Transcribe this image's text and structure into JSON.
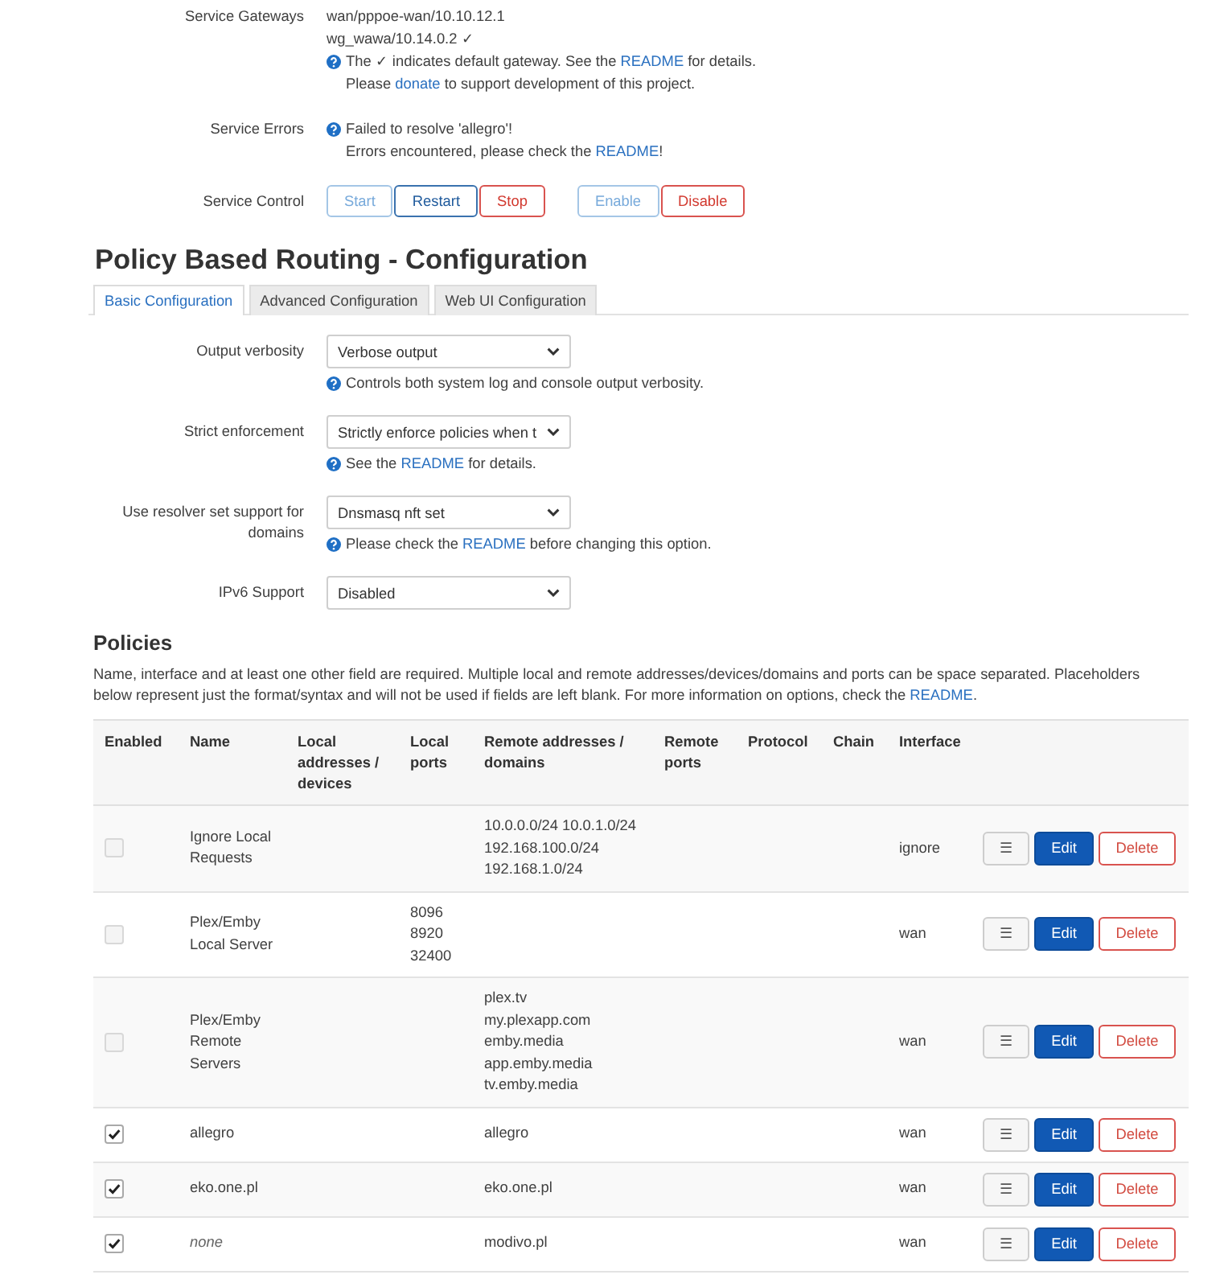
{
  "service": {
    "rows": [
      {
        "label": "Service Gateways",
        "lines": [
          "wan/pppoe-wan/10.10.12.1",
          "wg_wawa/10.14.0.2 ✓"
        ],
        "notes": [
          [
            {
              "kind": "text",
              "text": "The ✓ indicates default gateway. See the "
            },
            {
              "kind": "link",
              "text": "README"
            },
            {
              "kind": "text",
              "text": " for details."
            }
          ],
          [
            {
              "kind": "text",
              "text": "Please "
            },
            {
              "kind": "link",
              "text": "donate"
            },
            {
              "kind": "text",
              "text": " to support development of this project."
            }
          ]
        ]
      },
      {
        "label": "Service Errors",
        "notes": [
          [
            {
              "kind": "text",
              "text": "Failed to resolve 'allegro'!"
            }
          ],
          [
            {
              "kind": "text",
              "text": "Errors encountered, please check the "
            },
            {
              "kind": "link",
              "text": "README"
            },
            {
              "kind": "text",
              "text": "!"
            }
          ]
        ]
      }
    ],
    "control": {
      "label": "Service Control",
      "button_groups": [
        [
          {
            "label": "Start",
            "kind": "apply",
            "disabled": true
          },
          {
            "label": "Restart",
            "kind": "apply",
            "disabled": false
          },
          {
            "label": "Stop",
            "kind": "negative",
            "disabled": false
          }
        ],
        [
          {
            "label": "Enable",
            "kind": "apply",
            "disabled": true
          },
          {
            "label": "Disable",
            "kind": "negative",
            "disabled": false
          }
        ]
      ]
    }
  },
  "configuration": {
    "title": "Policy Based Routing - Configuration",
    "tabs": [
      {
        "label": "Basic Configuration",
        "selected": true
      },
      {
        "label": "Advanced Configuration",
        "selected": false
      },
      {
        "label": "Web UI Configuration",
        "selected": false
      }
    ],
    "fields": [
      {
        "label": "Output verbosity",
        "value": "Verbose output",
        "help": [
          {
            "kind": "text",
            "text": "Controls both system log and console output verbosity."
          }
        ]
      },
      {
        "label": "Strict enforcement",
        "value": "Strictly enforce policies when t",
        "help": [
          {
            "kind": "text",
            "text": "See the "
          },
          {
            "kind": "link",
            "text": "README"
          },
          {
            "kind": "text",
            "text": " for details."
          }
        ]
      },
      {
        "label": "Use resolver set support for domains",
        "value": "Dnsmasq nft set",
        "help": [
          {
            "kind": "text",
            "text": "Please check the "
          },
          {
            "kind": "link",
            "text": "README"
          },
          {
            "kind": "text",
            "text": " before changing this option."
          }
        ]
      },
      {
        "label": "IPv6 Support",
        "value": "Disabled"
      }
    ]
  },
  "policies": {
    "title": "Policies",
    "description": [
      {
        "kind": "text",
        "text": "Name, interface and at least one other field are required. Multiple local and remote addresses/devices/domains and ports can be space separated. Placeholders below represent just the format/syntax and will not be used if fields are left blank. For more information on options, check the "
      },
      {
        "kind": "link",
        "text": "README"
      },
      {
        "kind": "text",
        "text": "."
      }
    ],
    "table": {
      "columns": [
        "Enabled",
        "Name",
        "Local addresses / devices",
        "Local ports",
        "Remote addresses / domains",
        "Remote ports",
        "Protocol",
        "Chain",
        "Interface"
      ],
      "rows": [
        {
          "enabled": false,
          "name": "Ignore Local Requests",
          "name_is_placeholder": false,
          "remote_addresses": [
            "10.0.0.0/24 10.0.1.0/24",
            "192.168.100.0/24",
            "192.168.1.0/24"
          ],
          "interface": "ignore",
          "actions": [
            {
              "label": "☰",
              "kind": "handle"
            },
            {
              "label": "Edit",
              "kind": "edit"
            },
            {
              "label": "Delete",
              "kind": "delete"
            }
          ]
        },
        {
          "enabled": false,
          "name": "Plex/Emby Local Server",
          "name_is_placeholder": false,
          "local_ports": [
            "8096",
            "8920",
            "32400"
          ],
          "interface": "wan",
          "actions": [
            {
              "label": "☰",
              "kind": "handle"
            },
            {
              "label": "Edit",
              "kind": "edit"
            },
            {
              "label": "Delete",
              "kind": "delete"
            }
          ]
        },
        {
          "enabled": false,
          "name": "Plex/Emby Remote Servers",
          "name_is_placeholder": false,
          "remote_addresses": [
            "plex.tv",
            "my.plexapp.com",
            "emby.media",
            "app.emby.media",
            "tv.emby.media"
          ],
          "interface": "wan",
          "actions": [
            {
              "label": "☰",
              "kind": "handle"
            },
            {
              "label": "Edit",
              "kind": "edit"
            },
            {
              "label": "Delete",
              "kind": "delete"
            }
          ]
        },
        {
          "enabled": true,
          "name": "allegro",
          "name_is_placeholder": false,
          "remote_addresses": [
            "allegro"
          ],
          "interface": "wan",
          "actions": [
            {
              "label": "☰",
              "kind": "handle"
            },
            {
              "label": "Edit",
              "kind": "edit"
            },
            {
              "label": "Delete",
              "kind": "delete"
            }
          ]
        },
        {
          "enabled": true,
          "name": "eko.one.pl",
          "name_is_placeholder": false,
          "remote_addresses": [
            "eko.one.pl"
          ],
          "interface": "wan",
          "actions": [
            {
              "label": "☰",
              "kind": "handle"
            },
            {
              "label": "Edit",
              "kind": "edit"
            },
            {
              "label": "Delete",
              "kind": "delete"
            }
          ]
        },
        {
          "enabled": true,
          "name": "none",
          "name_is_placeholder": true,
          "remote_addresses": [
            "modivo.pl"
          ],
          "interface": "wan",
          "actions": [
            {
              "label": "☰",
              "kind": "handle"
            },
            {
              "label": "Edit",
              "kind": "edit"
            },
            {
              "label": "Delete",
              "kind": "delete"
            }
          ]
        }
      ]
    }
  }
}
